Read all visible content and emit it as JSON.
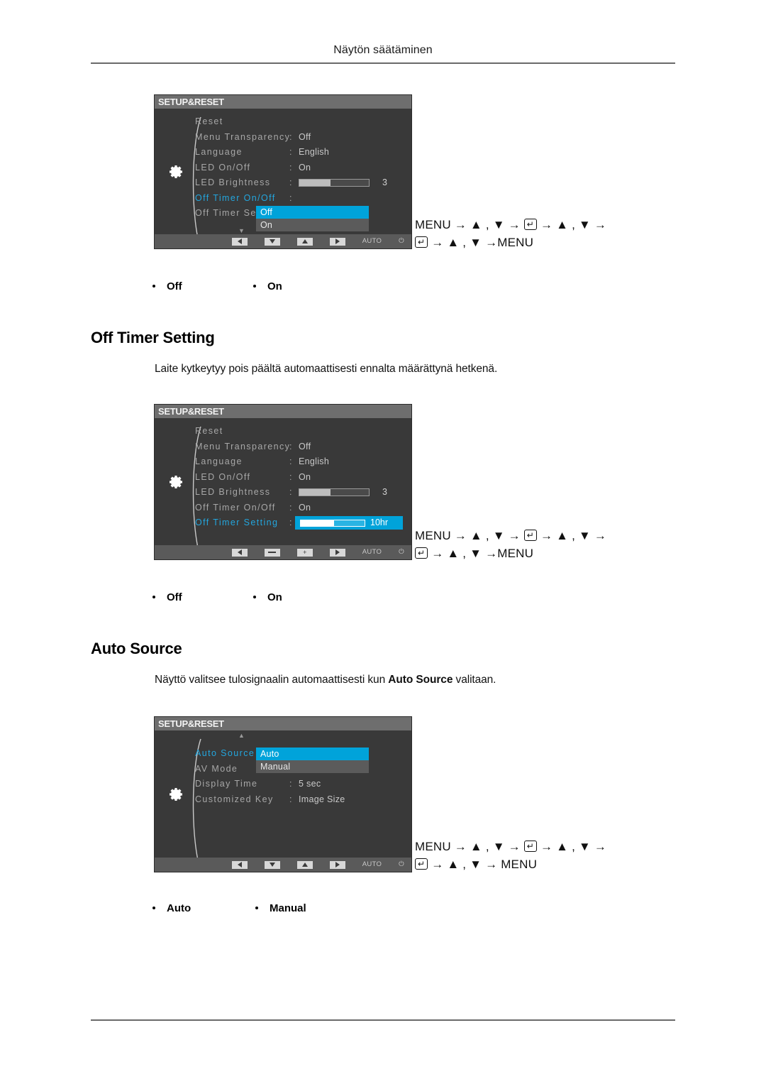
{
  "page": {
    "header": "Näytön säätäminen"
  },
  "sections": [
    {
      "id": "off-timer-onoff",
      "keyseq_line1_parts": [
        "MENU",
        "→",
        "▲",
        ",",
        "▼",
        "→",
        "↵",
        "→",
        "▲",
        ",",
        "▼",
        "→"
      ],
      "keyseq_line1": "MENU → ▲ , ▼ →",
      "keyseq_line1_tail": "→ ▲ , ▼ →",
      "keyseq_line2_tail": "→ ▲ , ▼ →MENU",
      "bullets": [
        "Off",
        "On"
      ],
      "osd": {
        "title": "SETUP&RESET",
        "rows": [
          {
            "label": "Reset",
            "colon": "",
            "value": "",
            "type": "plain",
            "active": false
          },
          {
            "label": "Menu Transparency",
            "colon": ":",
            "value": "Off",
            "type": "plain",
            "active": false
          },
          {
            "label": "Language",
            "colon": ":",
            "value": "English",
            "type": "plain",
            "active": false
          },
          {
            "label": "LED On/Off",
            "colon": ":",
            "value": "On",
            "type": "plain",
            "active": false
          },
          {
            "label": "LED Brightness",
            "colon": ":",
            "value": "3",
            "type": "slider",
            "fill_pct": 45,
            "active": false
          },
          {
            "label": "Off Timer On/Off",
            "colon": ":",
            "value": "",
            "type": "dropdown",
            "active": true
          },
          {
            "label": "Off Timer Setting",
            "colon": "",
            "value": "",
            "type": "plain",
            "active": false
          }
        ],
        "popup": {
          "options": [
            "Off",
            "On"
          ],
          "selected": "Off"
        },
        "scroll_arrow": "▼",
        "bar_buttons": [
          "tri-left",
          "tri-down",
          "tri-up",
          "tri-right",
          "AUTO",
          "power"
        ],
        "bar_auto_label": "AUTO"
      }
    },
    {
      "id": "off-timer-setting",
      "title": "Off Timer Setting",
      "body": "Laite kytkeytyy pois päältä automaattisesti ennalta määrättynä hetkenä.",
      "keyseq_line1": "MENU → ▲ , ▼ →",
      "keyseq_line1_tail": "→ ▲ , ▼ →",
      "keyseq_line2_tail": "→ ▲ , ▼ →MENU",
      "bullets": [
        "Off",
        "On"
      ],
      "osd": {
        "title": "SETUP&RESET",
        "rows": [
          {
            "label": "Reset",
            "colon": "",
            "value": "",
            "type": "plain",
            "active": false
          },
          {
            "label": "Menu Transparency",
            "colon": ":",
            "value": "Off",
            "type": "plain",
            "active": false
          },
          {
            "label": "Language",
            "colon": ":",
            "value": "English",
            "type": "plain",
            "active": false
          },
          {
            "label": "LED On/Off",
            "colon": ":",
            "value": "On",
            "type": "plain",
            "active": false
          },
          {
            "label": "LED Brightness",
            "colon": ":",
            "value": "3",
            "type": "slider",
            "fill_pct": 45,
            "active": false
          },
          {
            "label": "Off Timer On/Off",
            "colon": ":",
            "value": "On",
            "type": "plain",
            "active": false
          },
          {
            "label": "Off Timer Setting",
            "colon": ":",
            "value": "10hr",
            "type": "slider-hl",
            "fill_pct": 52,
            "active": true
          }
        ],
        "scroll_arrow": "▼",
        "bar_buttons": [
          "tri-left",
          "minus",
          "plus",
          "tri-right",
          "AUTO",
          "power"
        ],
        "bar_auto_label": "AUTO"
      }
    },
    {
      "id": "auto-source",
      "title": "Auto Source",
      "body_pre": "Näyttö valitsee tulosignaalin automaattisesti kun ",
      "body_bold": "Auto Source",
      "body_post": " valitaan.",
      "keyseq_line1": "MENU → ▲ , ▼ →",
      "keyseq_line1_tail": "→ ▲ , ▼ →",
      "keyseq_line2_tail": "→ ▲ , ▼ → MENU",
      "bullets": [
        "Auto",
        "Manual"
      ],
      "osd": {
        "title": "SETUP&RESET",
        "rows": [
          {
            "label": "Auto Source",
            "colon": ":",
            "value": "",
            "type": "dropdown",
            "active": true
          },
          {
            "label": "AV Mode",
            "colon": ":",
            "value": "",
            "type": "plain",
            "active": false
          },
          {
            "label": "Display Time",
            "colon": ":",
            "value": "5 sec",
            "type": "plain",
            "active": false
          },
          {
            "label": "Customized Key",
            "colon": ":",
            "value": "Image Size",
            "type": "plain",
            "active": false
          }
        ],
        "popup": {
          "options": [
            "Auto",
            "Manual"
          ],
          "selected": "Auto"
        },
        "scroll_arrow": "▲",
        "bar_buttons": [
          "tri-left",
          "tri-down",
          "tri-up",
          "tri-right",
          "AUTO",
          "power"
        ],
        "bar_auto_label": "AUTO"
      }
    }
  ],
  "colors": {
    "osd_panel": "#393939",
    "osd_titlebar": "#6e6e6e",
    "accent_blue": "#00a3da",
    "active_text": "#23a6de",
    "popup_gray": "#5b5b5b"
  }
}
